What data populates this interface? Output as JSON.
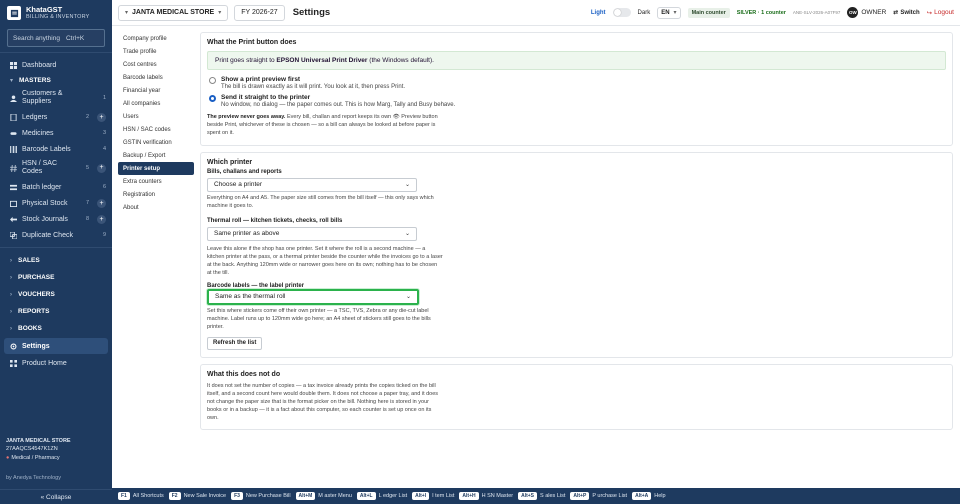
{
  "brand": {
    "name": "KhataGST",
    "sub": "BILLING & INVENTORY"
  },
  "search": {
    "placeholder": "Search anything",
    "shortcut": "Ctrl+K"
  },
  "sidebar": {
    "items": [
      {
        "label": "Dashboard",
        "icon": "dashboard-icon"
      },
      {
        "label": "MASTERS",
        "group": true
      },
      {
        "label": "Customers & Suppliers",
        "count": "1"
      },
      {
        "label": "Ledgers",
        "count": "2",
        "add": "+"
      },
      {
        "label": "Medicines",
        "count": "3"
      },
      {
        "label": "Barcode Labels",
        "count": "4"
      },
      {
        "label": "HSN / SAC Codes",
        "count": "5",
        "add": "+"
      },
      {
        "label": "Batch ledger",
        "count": "6"
      },
      {
        "label": "Physical Stock",
        "count": "7",
        "add": "+"
      },
      {
        "label": "Stock Journals",
        "count": "8",
        "add": "+"
      },
      {
        "label": "Duplicate Check",
        "count": "9"
      }
    ],
    "groups": [
      "SALES",
      "PURCHASE",
      "VOUCHERS",
      "REPORTS",
      "BOOKS"
    ],
    "settings_label": "Settings",
    "product_home_label": "Product Home",
    "collapse_label": "« Collapse"
  },
  "org": {
    "name": "JANTA MEDICAL STORE",
    "gstin": "27AAQCS4547K1ZN",
    "type": "Medical / Pharmacy",
    "powered": "by Anedya Technology"
  },
  "topbar": {
    "company": "JANTA MEDICAL STORE",
    "fy": "FY 2026-27",
    "title": "Settings",
    "theme_light": "Light",
    "theme_dark": "Dark",
    "lang": "EN",
    "counter": "Main counter",
    "plan": "SILVER · 1 counter",
    "license": "ANE-SLV-2026-A07F97",
    "avatar": "OW",
    "role": "OWNER",
    "switch": "Switch",
    "logout": "Logout"
  },
  "subnav": [
    "Company profile",
    "Trade profile",
    "Cost centres",
    "Barcode labels",
    "Financial year",
    "All companies",
    "Users",
    "HSN / SAC codes",
    "GSTIN verification",
    "Backup / Export",
    "Printer setup",
    "Extra counters",
    "Registration",
    "About"
  ],
  "subnav_active": "Printer setup",
  "print_button": {
    "heading": "What the Print button does",
    "banner_pre": "Print goes straight to ",
    "banner_bold": "EPSON Universal Print Driver",
    "banner_post": " (the Windows default).",
    "option1_title": "Show a print preview first",
    "option1_desc": "The bill is drawn exactly as it will print. You look at it, then press Print.",
    "option2_title": "Send it straight to the printer",
    "option2_desc": "No window, no dialog — the paper comes out. This is how Marg, Tally and Busy behave.",
    "note_bold": "The preview never goes away.",
    "note_text": " Every bill, challan and report keeps its own 👁 Preview button beside Print, whichever of these is chosen — so a bill can always be looked at before paper is spent on it."
  },
  "which_printer": {
    "heading": "Which printer",
    "bills_label": "Bills, challans and reports",
    "bills_value": "Choose a printer",
    "bills_note": "Everything on A4 and A5. The paper size still comes from the bill itself — this only says which machine it goes to.",
    "thermal_label": "Thermal roll — kitchen tickets, checks, roll bills",
    "thermal_value": "Same printer as above",
    "thermal_note": "Leave this alone if the shop has one printer. Set it where the roll is a second machine — a kitchen printer at the pass, or a thermal printer beside the counter while the invoices go to a laser at the back. Anything 120mm wide or narrower goes here on its own; nothing has to be chosen at the till.",
    "label_label": "Barcode labels — the label printer",
    "label_value": "Same as the thermal roll",
    "label_note": "Set this where stickers come off their own printer — a TSC, TVS, Zebra or any die-cut label machine. Label runs up to 120mm wide go here; an A4 sheet of stickers still goes to the bills printer.",
    "refresh_label": "Refresh the list"
  },
  "not_do": {
    "heading": "What this does not do",
    "text": "It does not set the number of copies — a tax invoice already prints the copies ticked on the bill itself, and a second count here would double them. It does not choose a paper tray, and it does not change the paper size that is the format picker on the bill. Nothing here is stored in your books or in a backup — it is a fact about this computer, so each counter is set up once on its own."
  },
  "shortcuts": [
    {
      "key": "F1",
      "label": "All Shortcuts"
    },
    {
      "key": "F2",
      "label": "New Sale Invoice"
    },
    {
      "key": "F3",
      "label": "New Purchase Bill"
    },
    {
      "key": "Alt+M",
      "label": "M aster Menu"
    },
    {
      "key": "Alt+L",
      "label": "L edger List"
    },
    {
      "key": "Alt+I",
      "label": "I tem List"
    },
    {
      "key": "Alt+H",
      "label": "H SN Master"
    },
    {
      "key": "Alt+S",
      "label": "S ales List"
    },
    {
      "key": "Alt+P",
      "label": "P urchase List"
    },
    {
      "key": "Alt+A",
      "label": "Help"
    }
  ]
}
